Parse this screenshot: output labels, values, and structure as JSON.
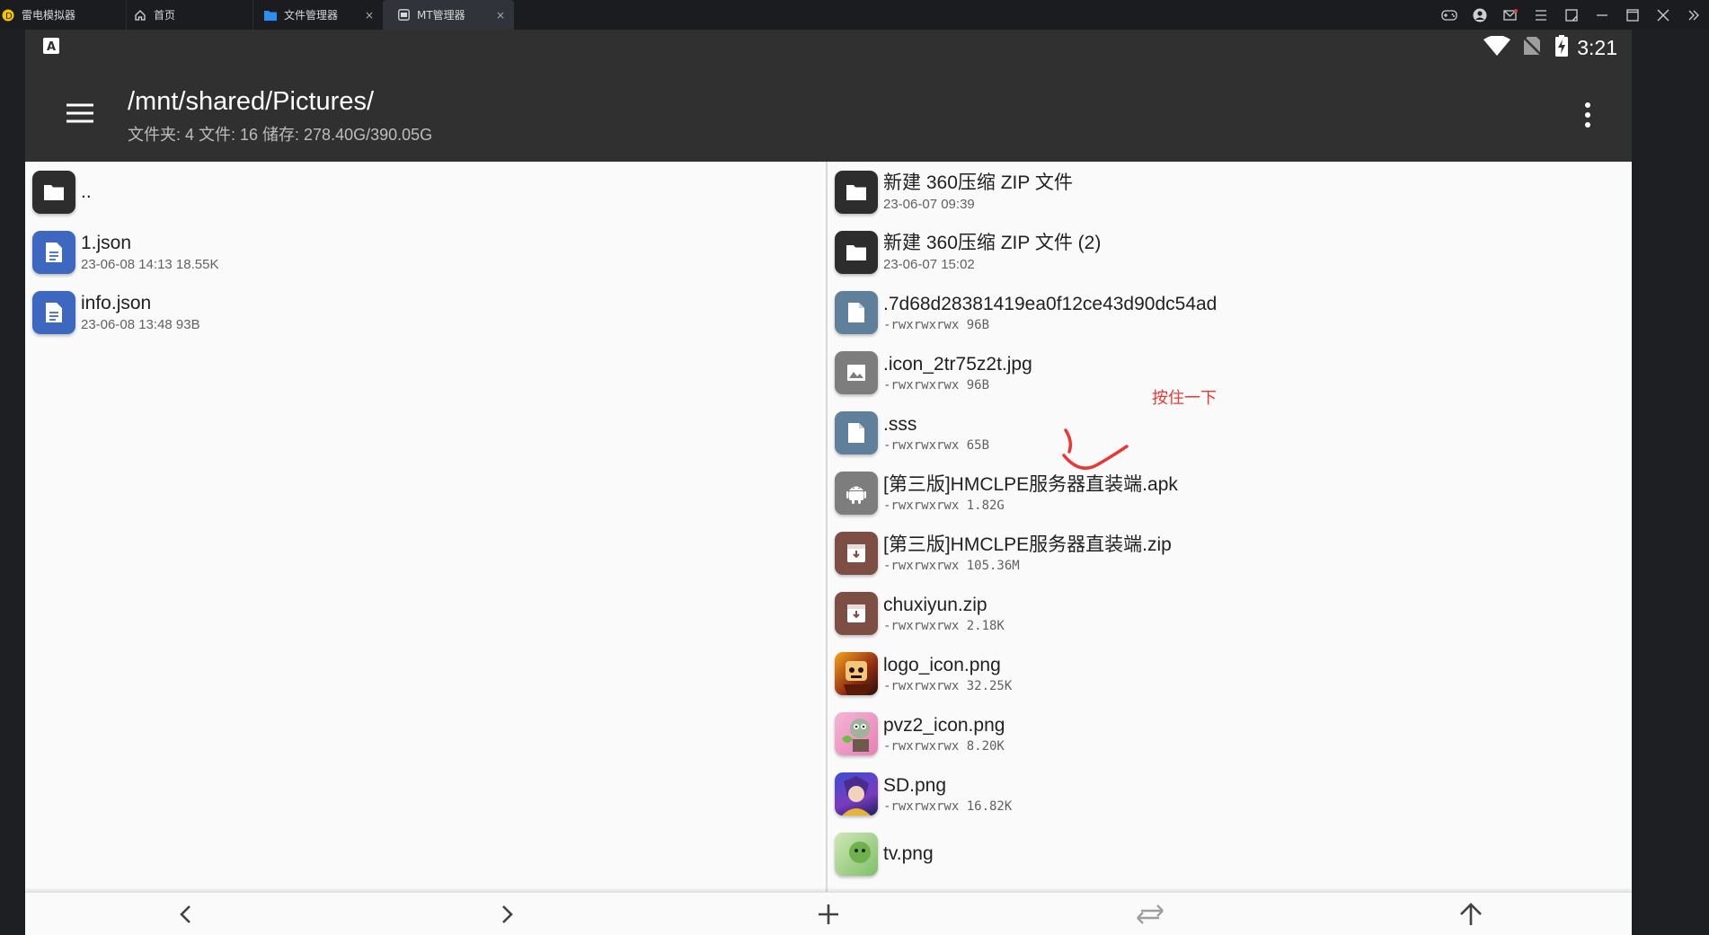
{
  "titlebar": {
    "app_name": "雷电模拟器",
    "tabs": [
      {
        "label": "首页"
      },
      {
        "label": "文件管理器",
        "close": "×"
      },
      {
        "label": "MT管理器",
        "close": "×"
      }
    ]
  },
  "statusbar": {
    "time": "3:21",
    "keyboard_icon_letter": "A"
  },
  "appbar": {
    "path": "/mnt/shared/Pictures/",
    "summary": "文件夹: 4  文件: 16  储存: 278.40G/390.05G"
  },
  "left_pane": {
    "items": [
      {
        "name": "..",
        "info": "",
        "icon": "folder-icon"
      },
      {
        "name": "1.json",
        "info": "23-06-08 14:13  18.55K",
        "icon": "document-icon"
      },
      {
        "name": "info.json",
        "info": "23-06-08 13:48  93B",
        "icon": "document-icon"
      }
    ]
  },
  "right_pane": {
    "items": [
      {
        "name": "新建 360压缩 ZIP 文件",
        "info": "23-06-07 09:39",
        "icon": "folder-icon"
      },
      {
        "name": "新建 360压缩 ZIP 文件 (2)",
        "info": "23-06-07 15:02",
        "icon": "folder-icon"
      },
      {
        "name": ".7d68d28381419ea0f12ce43d90dc54ad",
        "info": "-rwxrwxrwx  96B",
        "icon": "document-icon"
      },
      {
        "name": ".icon_2tr75z2t.jpg",
        "info": "-rwxrwxrwx  96B",
        "icon": "image-icon"
      },
      {
        "name": ".sss",
        "info": "-rwxrwxrwx  65B",
        "icon": "document-icon"
      },
      {
        "name": "[第三版]HMCLPE服务器直装端.apk",
        "info": "-rwxrwxrwx  1.82G",
        "icon": "android-icon"
      },
      {
        "name": "[第三版]HMCLPE服务器直装端.zip",
        "info": "-rwxrwxrwx  105.36M",
        "icon": "archive-icon"
      },
      {
        "name": "chuxiyun.zip",
        "info": "-rwxrwxrwx  2.18K",
        "icon": "archive-icon"
      },
      {
        "name": "logo_icon.png",
        "info": "-rwxrwxrwx  32.25K",
        "icon": "thumbnail-image"
      },
      {
        "name": "pvz2_icon.png",
        "info": "-rwxrwxrwx  8.20K",
        "icon": "thumbnail-image"
      },
      {
        "name": "SD.png",
        "info": "-rwxrwxrwx  16.82K",
        "icon": "thumbnail-image"
      },
      {
        "name": "tv.png",
        "info": "",
        "icon": "thumbnail-image"
      }
    ]
  },
  "annotation": {
    "text": "按住一下",
    "color": "#e53935"
  },
  "bottombar": {
    "buttons": [
      "back-icon",
      "forward-icon",
      "add-icon",
      "swap-icon",
      "up-icon"
    ]
  },
  "colors": {
    "appbar": "#303030",
    "folder": "#2d2d2d",
    "doc_blue": "#3e68c0",
    "doc_grey": "#5f7f9a",
    "archive": "#7d4e43"
  }
}
